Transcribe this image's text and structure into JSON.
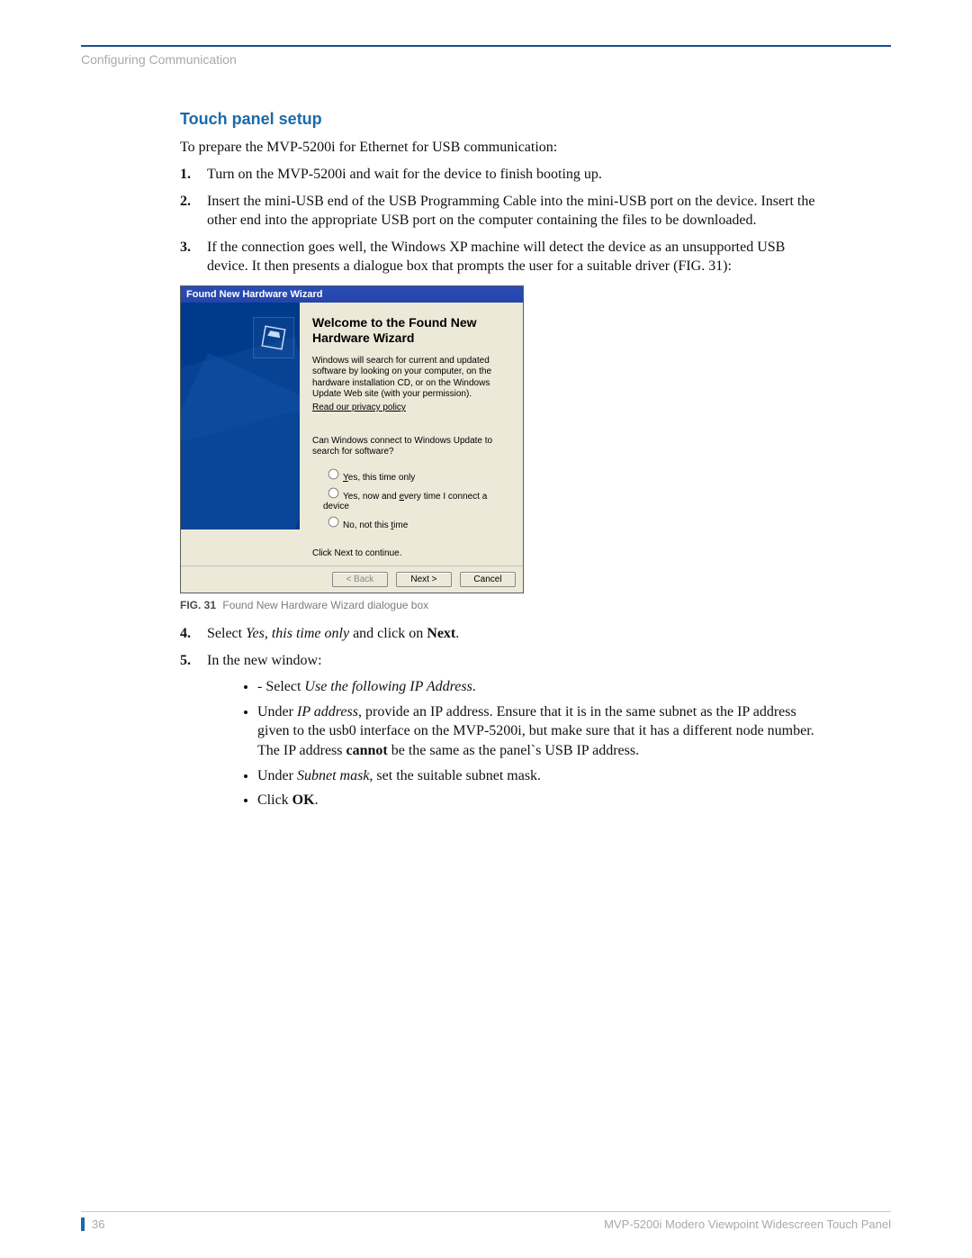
{
  "header": {
    "running_title": "Configuring Communication"
  },
  "section": {
    "title": "Touch panel setup",
    "intro": "To prepare the MVP-5200i for Ethernet for USB communication:"
  },
  "steps": {
    "s1": {
      "num": "1.",
      "text": "Turn on the MVP-5200i and wait for the device to finish booting up."
    },
    "s2": {
      "num": "2.",
      "text": "Insert the mini-USB end of the USB Programming Cable into the mini-USB port on the device. Insert the other end into the appropriate USB port on the computer containing the files to be downloaded."
    },
    "s3": {
      "num": "3.",
      "text": "If the connection goes well, the Windows XP machine will detect the device as an unsupported USB device. It then presents a dialogue box that prompts the user for a suitable driver (FIG. 31):"
    },
    "s4": {
      "num": "4.",
      "pre": "Select ",
      "italic": "Yes, this time only",
      "mid": " and click on ",
      "bold": "Next",
      "post": "."
    },
    "s5": {
      "num": "5.",
      "text": "In the new window:",
      "b1_pre": "- Select ",
      "b1_italic": "Use the following IP Address",
      "b1_post": ".",
      "b2_pre": "Under ",
      "b2_italic": "IP address",
      "b2_mid": ", provide an IP address. Ensure that it is in the same subnet as the IP address given to the usb0 interface on the MVP-5200i, but make sure that it has a different node number. The IP address ",
      "b2_bold": "cannot",
      "b2_post": " be the same as the panel`s USB IP address.",
      "b3_pre": "Under ",
      "b3_italic": "Subnet mask",
      "b3_post": ", set the suitable subnet mask.",
      "b4_pre": "Click ",
      "b4_bold": "OK",
      "b4_post": "."
    }
  },
  "dialog": {
    "title": "Found New Hardware Wizard",
    "heading": "Welcome to the Found New Hardware Wizard",
    "desc": "Windows will search for current and updated software by looking on your computer, on the hardware installation CD, or on the Windows Update Web site (with your permission).",
    "privacy": "Read our privacy policy",
    "question": "Can Windows connect to Windows Update to search for software?",
    "opt1_pre": "Y",
    "opt1_rest": "es, this time only",
    "opt2_pre": "Yes, now and ",
    "opt2_u": "e",
    "opt2_rest": "very time I connect a device",
    "opt3_pre": "No, not this ",
    "opt3_u": "t",
    "opt3_rest": "ime",
    "continue": "Click Next to continue.",
    "btn_back": "< Back",
    "btn_next": "Next >",
    "btn_cancel": "Cancel"
  },
  "figure": {
    "label": "FIG. 31",
    "caption": "Found New Hardware Wizard dialogue box"
  },
  "footer": {
    "page": "36",
    "doc_title": "MVP-5200i Modero Viewpoint Widescreen Touch Panel"
  }
}
